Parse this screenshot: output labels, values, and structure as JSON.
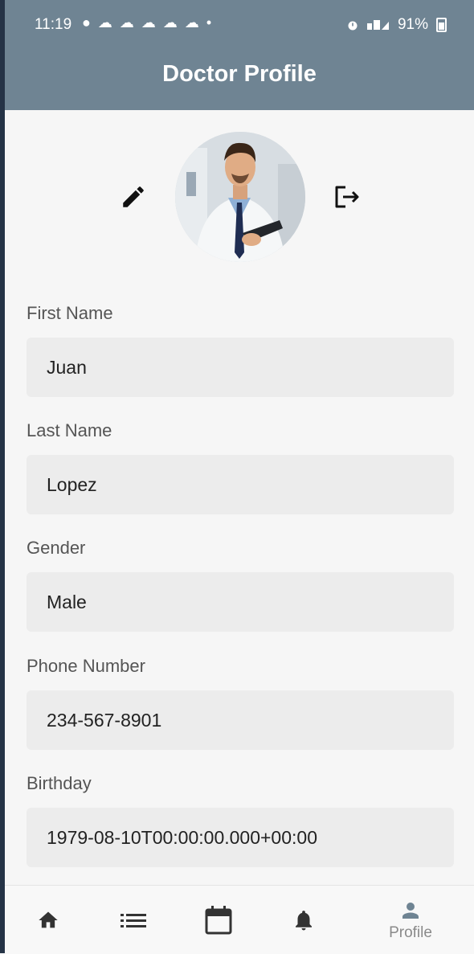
{
  "status_bar": {
    "time": "11:19",
    "notifications": "● ☁ ☁ ☁ ☁ ☁ •",
    "battery": "91%"
  },
  "header": {
    "title": "Doctor Profile"
  },
  "profile": {
    "edit_icon": "pencil-icon",
    "logout_icon": "logout-icon"
  },
  "fields": [
    {
      "label": "First Name",
      "value": "Juan"
    },
    {
      "label": "Last Name",
      "value": "Lopez"
    },
    {
      "label": "Gender",
      "value": "Male"
    },
    {
      "label": "Phone Number",
      "value": "234-567-8901"
    },
    {
      "label": "Birthday",
      "value": "1979-08-10T00:00:00.000+00:00"
    }
  ],
  "nav": {
    "items": [
      {
        "icon": "home-icon"
      },
      {
        "icon": "list-icon"
      },
      {
        "icon": "calendar-icon"
      },
      {
        "icon": "bell-icon"
      },
      {
        "icon": "person-icon",
        "label": "Profile"
      }
    ]
  },
  "colors": {
    "header": "#6f8493",
    "field_bg": "#ececec",
    "page_bg": "#f6f6f6"
  }
}
